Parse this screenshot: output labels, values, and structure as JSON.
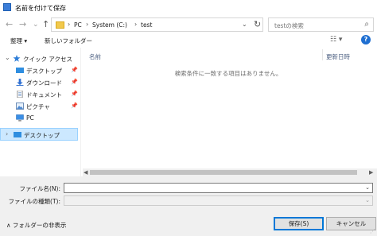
{
  "window": {
    "title": "名前を付けて保存"
  },
  "nav": {
    "back": "←",
    "forward": "→",
    "recent": "⌄",
    "up": "↑",
    "address": {
      "segments": [
        "PC",
        "System (C:)",
        "test"
      ],
      "separator": "›",
      "dropdown": "⌄",
      "refresh": "↻"
    },
    "search": {
      "placeholder": "testの検索",
      "icon": "⌕"
    }
  },
  "toolbar": {
    "organize": "整理 ▾",
    "new_folder": "新しいフォルダー",
    "view": "☷ ▾",
    "help": "?"
  },
  "sidebar": {
    "items": [
      {
        "label": "クイック アクセス",
        "icon": "star-icon",
        "arrow": "⌄"
      },
      {
        "label": "デスクトップ",
        "icon": "desktop-icon",
        "pin": "📌"
      },
      {
        "label": "ダウンロード",
        "icon": "download-icon",
        "pin": "📌"
      },
      {
        "label": "ドキュメント",
        "icon": "document-icon",
        "pin": "📌"
      },
      {
        "label": "ピクチャ",
        "icon": "pictures-icon",
        "pin": "📌"
      },
      {
        "label": "PC",
        "icon": "pc-icon"
      },
      {
        "label": "デスクトップ",
        "icon": "desktop-icon",
        "arrow": "›",
        "selected": true
      }
    ]
  },
  "filelist": {
    "columns": [
      "名前",
      "更新日時"
    ],
    "empty_message": "検索条件に一致する項目はありません。"
  },
  "scrollbar": {
    "left": "◀",
    "right": "▶"
  },
  "form": {
    "filename_label": "ファイル名(N):",
    "filename_value": "",
    "filetype_label": "ファイルの種類(T):",
    "filetype_value": "",
    "dropdown": "⌄"
  },
  "footer": {
    "hide_folders": "∧ フォルダーの非表示",
    "save": "保存(S)",
    "cancel": "キャンセル",
    "grip": "⋰"
  },
  "colors": {
    "accent": "#0078d7",
    "selection": "#cce8ff",
    "folder": "#f2c94c",
    "dialog_bg": "#f0f0f0"
  }
}
